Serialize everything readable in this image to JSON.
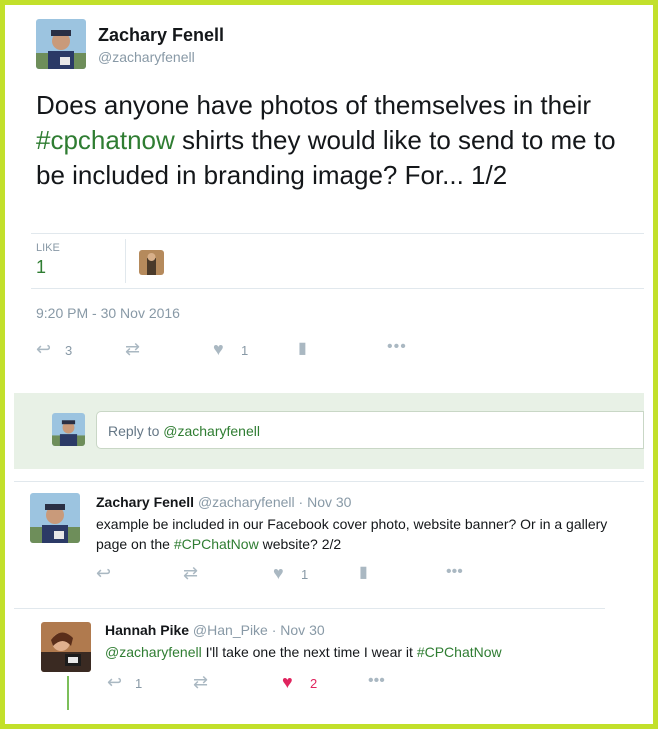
{
  "main_tweet": {
    "name": "Zachary Fenell",
    "handle": "@zacharyfenell",
    "text_before": "Does anyone have photos of themselves in their ",
    "hashtag": "#cpchatnow",
    "text_after": " shirts they would like to send to me to be included in branding image? For... 1/2",
    "like_label": "LIKE",
    "like_count": "1",
    "timestamp": "9:20 PM - 30 Nov 2016",
    "reply_count": "3",
    "fav_count": "1"
  },
  "reply_box": {
    "prefix": "Reply to ",
    "mention": "@zacharyfenell"
  },
  "tweet2": {
    "name": "Zachary Fenell",
    "handle": "@zacharyfenell",
    "date": "· Nov 30",
    "text_before": "example be included in our Facebook cover photo, website banner? Or in a gallery page on the ",
    "hashtag": "#CPChatNow",
    "text_after": " website? 2/2",
    "fav_count": "1"
  },
  "tweet3": {
    "name": "Hannah Pike",
    "handle": "@Han_Pike",
    "date": "· Nov 30",
    "mention": "@zacharyfenell",
    "text_middle": " I'll take one the next time I wear it ",
    "hashtag": "#CPChatNow",
    "reply_count": "1",
    "fav_count": "2"
  },
  "colors": {
    "frame": "#c2e02b",
    "link": "#2f7d32",
    "liked": "#e0245e",
    "reply_bg": "#e8f1e6"
  },
  "icons": [
    "reply-icon",
    "retweet-icon",
    "heart-icon",
    "analytics-icon",
    "more-icon"
  ]
}
